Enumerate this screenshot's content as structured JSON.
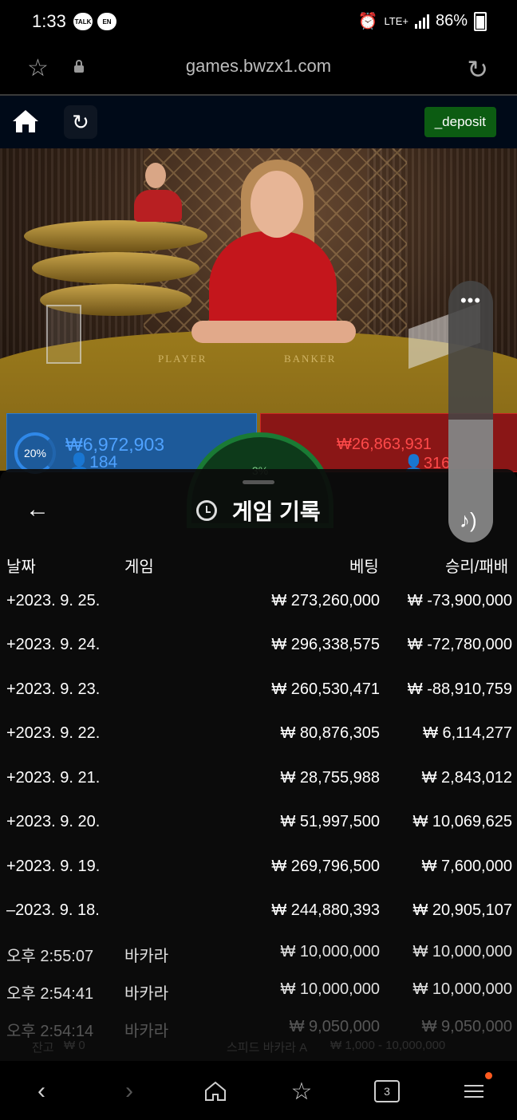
{
  "status_bar": {
    "time": "1:33",
    "notif_talk": "TALK",
    "notif_en": "EN",
    "network": "LTE+",
    "battery": "86%"
  },
  "browser": {
    "url": "games.bwzx1.com"
  },
  "site_header": {
    "deposit_label": "_deposit"
  },
  "video": {
    "player_label": "PLAYER",
    "banker_label": "BANKER"
  },
  "stats": {
    "player_percent": "20%",
    "player_amount": "₩6,972,903",
    "player_count": "184",
    "center_percent": "3%",
    "banker_amount": "₩26,863,931",
    "banker_count": "316"
  },
  "history_panel": {
    "title": "게임 기록",
    "columns": [
      "날짜",
      "게임",
      "베팅",
      "승리/패배"
    ],
    "date_rows": [
      {
        "date": "+2023. 9. 25.",
        "bet": "₩ 273,260,000",
        "result": "₩ -73,900,000"
      },
      {
        "date": "+2023. 9. 24.",
        "bet": "₩ 296,338,575",
        "result": "₩ -72,780,000"
      },
      {
        "date": "+2023. 9. 23.",
        "bet": "₩ 260,530,471",
        "result": "₩ -88,910,759"
      },
      {
        "date": "+2023. 9. 22.",
        "bet": "₩ 80,876,305",
        "result": "₩ 6,114,277"
      },
      {
        "date": "+2023. 9. 21.",
        "bet": "₩ 28,755,988",
        "result": "₩ 2,843,012"
      },
      {
        "date": "+2023. 9. 20.",
        "bet": "₩ 51,997,500",
        "result": "₩ 10,069,625"
      },
      {
        "date": "+2023. 9. 19.",
        "bet": "₩ 269,796,500",
        "result": "₩ 7,600,000"
      },
      {
        "date": "–2023. 9. 18.",
        "bet": "₩ 244,880,393",
        "result": "₩ 20,905,107"
      }
    ],
    "sub_rows": [
      {
        "time": "오후 2:55:07",
        "game": "바카라",
        "bet": "₩ 10,000,000",
        "result": "₩ 10,000,000"
      },
      {
        "time": "오후 2:54:41",
        "game": "바카라",
        "bet": "₩ 10,000,000",
        "result": "₩ 10,000,000"
      },
      {
        "time": "오후 2:54:14",
        "game": "바카라",
        "bet": "₩ 9,050,000",
        "result": "₩ 9,050,000"
      }
    ]
  },
  "background_ghost": {
    "balance_label": "잔고",
    "balance_value": "₩ 0",
    "table_name": "스피드 바카라 A",
    "limits": "₩ 1,000 - 10,000,000"
  },
  "nav_bar": {
    "tab_count": "3"
  }
}
